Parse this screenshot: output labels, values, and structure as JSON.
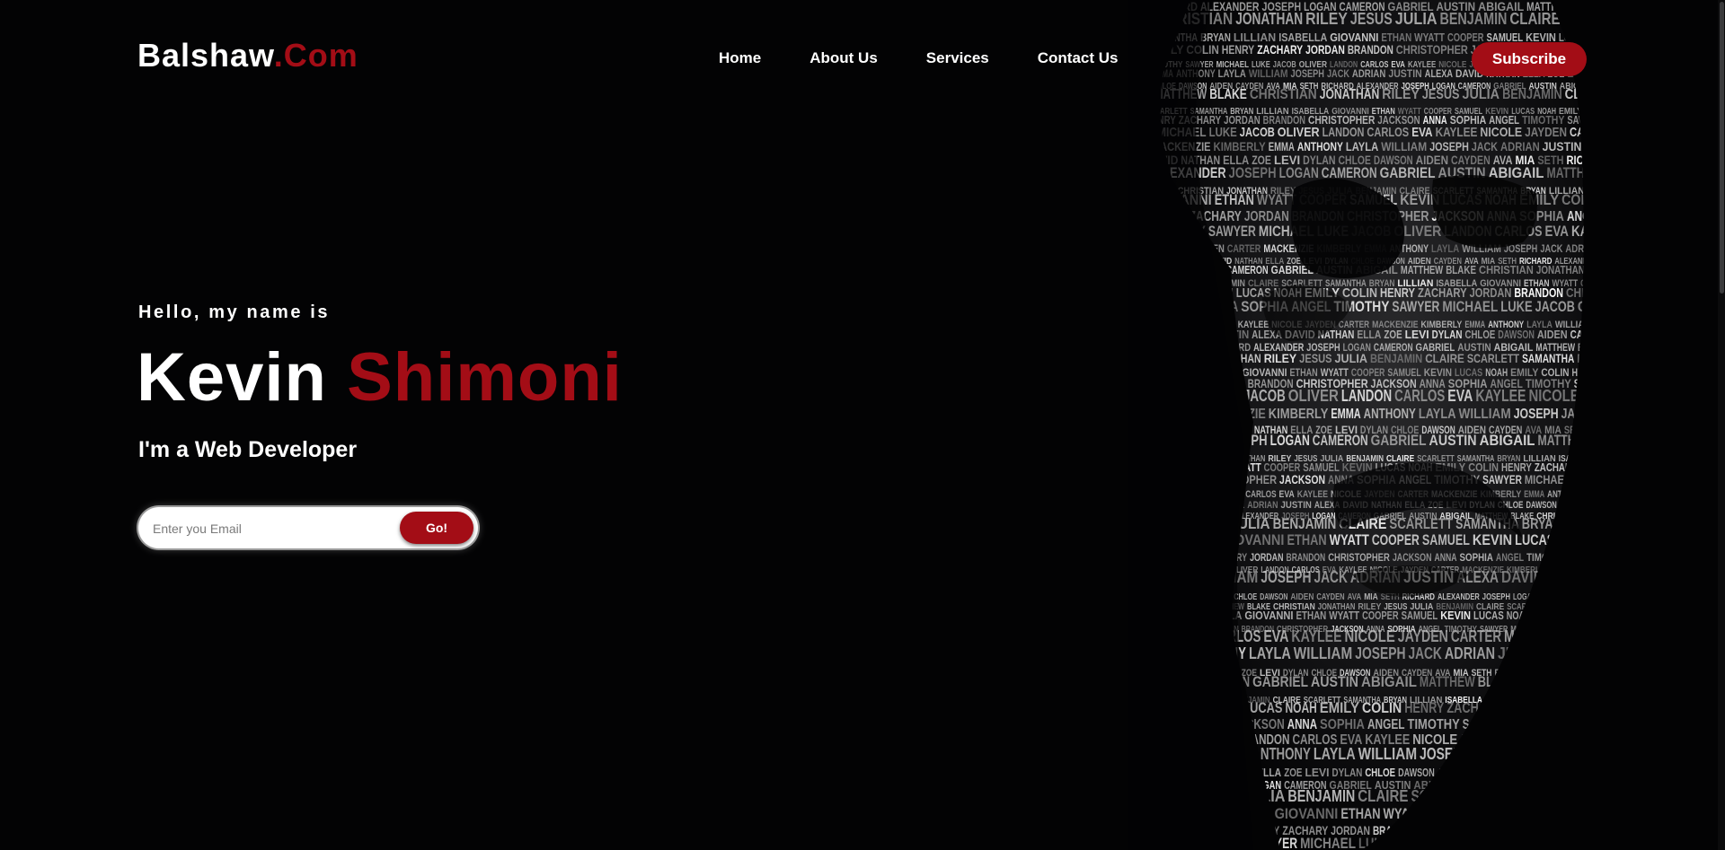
{
  "theme": {
    "accent_color": "#a30d16",
    "background_color": "#030304",
    "text_color": "#ffffff"
  },
  "header": {
    "logo_main": "Balshaw",
    "logo_accent": ".Com",
    "nav": [
      {
        "label": "Home"
      },
      {
        "label": "About Us"
      },
      {
        "label": "Services"
      },
      {
        "label": "Contact Us"
      }
    ],
    "subscribe_label": "Subscribe"
  },
  "hero": {
    "greeting": "Hello, my name is",
    "first_name": "Kevin",
    "last_name": "Shimoni",
    "role": "I'm a Web Developer",
    "email_placeholder": "Enter you Email",
    "email_value": "",
    "go_label": "Go!"
  },
  "art": {
    "icon": "word-mosaic-mask-image",
    "words": [
      "RICHARD",
      "ALEXANDER",
      "JOSEPH",
      "LOGAN",
      "CAMERON",
      "GABRIEL",
      "AUSTIN",
      "ABIGAIL",
      "MATTHEW",
      "BLAKE",
      "CHRISTIAN",
      "JONATHAN",
      "RILEY",
      "JESUS",
      "JULIA",
      "BENJAMIN",
      "CLAIRE",
      "SCARLETT",
      "SAMANTHA",
      "BRYAN",
      "LILLIAN",
      "ISABELLA",
      "GIOVANNI",
      "ETHAN",
      "WYATT",
      "COOPER",
      "SAMUEL",
      "KEVIN",
      "LUCAS",
      "NOAH",
      "EMILY",
      "COLIN",
      "HENRY",
      "ZACHARY",
      "JORDAN",
      "BRANDON",
      "CHRISTOPHER",
      "JACKSON",
      "ANNA",
      "SOPHIA",
      "ANGEL",
      "TIMOTHY",
      "SAWYER",
      "MICHAEL",
      "LUKE",
      "JACOB",
      "OLIVER",
      "LANDON",
      "CARLOS",
      "EVA",
      "KAYLEE",
      "NICOLE",
      "JAYDEN",
      "CARTER",
      "MACKENZIE",
      "KIMBERLY",
      "EMMA",
      "ANTHONY",
      "LAYLA",
      "WILLIAM",
      "JOSEPH",
      "JACK",
      "ADRIAN",
      "JUSTIN",
      "ALEXA",
      "DAVID",
      "NATHAN",
      "ELLA",
      "ZOE",
      "LEVI",
      "DYLAN",
      "CHLOE",
      "DAWSON",
      "AIDEN",
      "CAYDEN",
      "AVA",
      "MIA",
      "SETH"
    ]
  }
}
